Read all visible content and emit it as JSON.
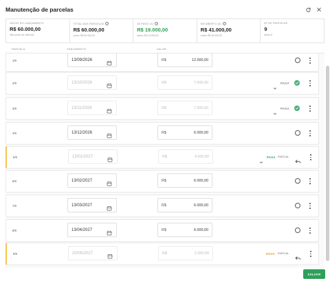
{
  "header": {
    "title": "Manutenção de parcelas",
    "refresh_icon": "refresh-icon",
    "close_icon": "close-icon"
  },
  "summary": [
    {
      "label": "Valor do lançamento",
      "value": "R$ 60.000,00",
      "sub": "Não pode ser alterado",
      "info": false,
      "accent": ""
    },
    {
      "label": "Total das parcelas",
      "value": "R$ 60.000,00",
      "sub": "prazo R$ 60.000,00",
      "info": true,
      "accent": ""
    },
    {
      "label": "Já pago (3)",
      "value": "R$ 19.000,00",
      "sub": "antes R$ 15.000,00",
      "info": true,
      "accent": "green"
    },
    {
      "label": "Em aberto (6)",
      "value": "R$ 41.000,00",
      "sub": "antes R$ 45.000,00",
      "info": true,
      "accent": ""
    },
    {
      "label": "Nº de parcelas",
      "value": "9",
      "sub": "antes 8",
      "info": false,
      "accent": ""
    }
  ],
  "columns": {
    "parcela": "PARCELA",
    "vencimento": "VENCIMENTO",
    "valor": "VALOR"
  },
  "currency": "R$",
  "rows": [
    {
      "num": "1/9",
      "date": "13/09/2026",
      "amount": "12.000,00",
      "state": "open",
      "status": "",
      "partial": "",
      "faded": false
    },
    {
      "num": "2/9",
      "date": "13/10/2026",
      "amount": "7.500,00",
      "state": "paid",
      "status": "PAGA",
      "partial": "",
      "faded": true
    },
    {
      "num": "3/9",
      "date": "13/11/2026",
      "amount": "7.500,00",
      "state": "paid",
      "status": "PAGA",
      "partial": "",
      "faded": true
    },
    {
      "num": "4/9",
      "date": "13/12/2026",
      "amount": "6.000,00",
      "state": "open",
      "status": "",
      "partial": "",
      "faded": false
    },
    {
      "num": "5/9",
      "date": "13/01/2027",
      "amount": "4.000,00",
      "state": "partial",
      "status": "PAGA",
      "partial": "PARCIAL",
      "faded": true
    },
    {
      "num": "6/9",
      "date": "13/02/2027",
      "amount": "6.000,00",
      "state": "open",
      "status": "",
      "partial": "",
      "faded": false
    },
    {
      "num": "7/9",
      "date": "13/03/2027",
      "amount": "6.000,00",
      "state": "open",
      "status": "",
      "partial": "",
      "faded": false
    },
    {
      "num": "8/9",
      "date": "13/04/2027",
      "amount": "6.000,00",
      "state": "open",
      "status": "",
      "partial": "",
      "faded": false
    },
    {
      "num": "9/9",
      "date": "20/05/2027",
      "amount": "2.000,00",
      "state": "nova",
      "status": "NOVA",
      "partial": "PARCIAL",
      "faded": true
    }
  ],
  "footer": {
    "save_label": "SALVAR"
  },
  "colors": {
    "accent_green": "#2ea05a",
    "paga_green": "#3a9d62",
    "nova_amber": "#e0a020",
    "partial_border": "#f5c24a"
  }
}
